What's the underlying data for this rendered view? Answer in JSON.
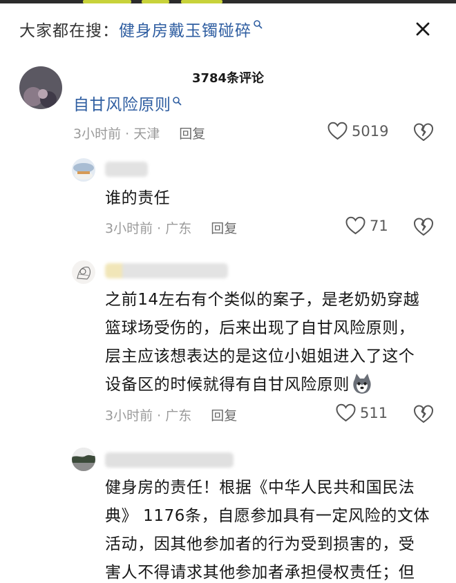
{
  "search": {
    "prefix": "大家都在搜：",
    "term": "健身房戴玉镯碰碎",
    "close_icon": "close-icon"
  },
  "header": {
    "count_label": "3784条评论"
  },
  "colors": {
    "accent_blue": "#2f5ea1",
    "meta_gray": "#9a9a9a",
    "reply_gray": "#6b6b6b"
  },
  "comments": [
    {
      "text": "自甘风险原则",
      "keyword": true,
      "time_location": "3小时前 · 天津",
      "reply": "回复",
      "likes": "5019"
    },
    {
      "text": "谁的责任",
      "time_location": "3小时前 · 广东",
      "reply": "回复",
      "likes": "71"
    },
    {
      "lines": [
        "之前14左右有个类似的案子，是老奶奶穿越",
        "篮球场受伤的，后来出现了自甘风险原则，",
        "层主应该想表达的是这位小姐姐进入了这个",
        "设备区的时候就得有自甘风险原则"
      ],
      "emoji": "husky-emoji",
      "time_location": "3小时前 · 广东",
      "reply": "回复",
      "likes": "511"
    },
    {
      "lines": [
        "健身房的责任！根据《中华人民共和国民法",
        "典》 1176条，自愿参加具有一定风险的文体",
        "活动，因其他参加者的行为受到损害的，受",
        "害人不得请求其他参加者承担侵权责任；但"
      ]
    }
  ]
}
